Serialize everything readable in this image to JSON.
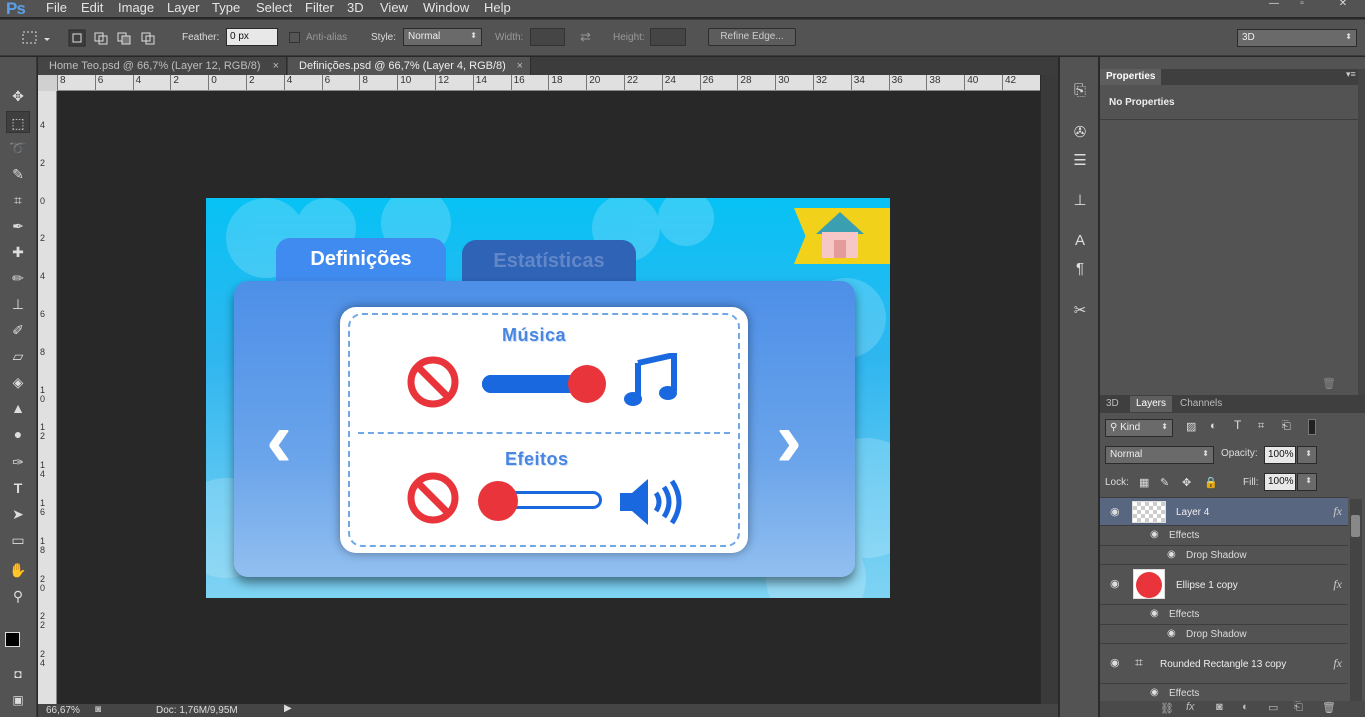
{
  "app": {
    "logo": "Ps"
  },
  "menu": [
    "File",
    "Edit",
    "Image",
    "Layer",
    "Type",
    "Select",
    "Filter",
    "3D",
    "View",
    "Window",
    "Help"
  ],
  "window_controls": [
    "—",
    "▫",
    "✕"
  ],
  "options": {
    "feather_label": "Feather:",
    "feather_value": "0 px",
    "antialias_label": "Anti-alias",
    "style_label": "Style:",
    "style_value": "Normal",
    "width_label": "Width:",
    "height_label": "Height:",
    "refine_edge": "Refine Edge...",
    "workspace": "3D"
  },
  "doc_tabs": [
    {
      "label": "Home Teo.psd @ 66,7% (Layer 12, RGB/8)",
      "close": "×"
    },
    {
      "label": "Definições.psd @ 66,7% (Layer 4, RGB/8)",
      "close": "×"
    }
  ],
  "ruler_top": [
    "8",
    "6",
    "4",
    "2",
    "0",
    "2",
    "4",
    "6",
    "8",
    "10",
    "12",
    "14",
    "16",
    "18",
    "20",
    "22",
    "24",
    "26",
    "28",
    "30",
    "32",
    "34",
    "36",
    "38",
    "40",
    "42"
  ],
  "ruler_left": [
    "4",
    "2",
    "0",
    "2",
    "4",
    "6",
    "8",
    "10",
    "12",
    "14",
    "16",
    "18",
    "20",
    "22",
    "24"
  ],
  "status": {
    "zoom": "66,67%",
    "doc": "Doc: 1,76M/9,95M"
  },
  "properties": {
    "tab": "Properties",
    "empty": "No Properties"
  },
  "layer_panel": {
    "tabs": [
      "3D",
      "Layers",
      "Channels"
    ],
    "kind": "Kind",
    "blend_mode": "Normal",
    "opacity_label": "Opacity:",
    "opacity_value": "100%",
    "lock_label": "Lock:",
    "fill_label": "Fill:",
    "fill_value": "100%",
    "fx_label": "fx",
    "layers": [
      {
        "name": "Layer 4",
        "effects_label": "Effects",
        "effect": "Drop Shadow"
      },
      {
        "name": "Ellipse 1 copy",
        "effects_label": "Effects",
        "effect": "Drop Shadow"
      },
      {
        "name": "Rounded Rectangle 13 copy",
        "effects_label": "Effects"
      }
    ]
  },
  "art": {
    "tab_active": "Definições",
    "tab_inactive": "Estatísticas",
    "music_title": "Música",
    "effects_title": "Efeitos",
    "music_level": 1.0,
    "effects_level": 0.0,
    "accent_red": "#e8343a",
    "accent_blue": "#1a68e0"
  }
}
